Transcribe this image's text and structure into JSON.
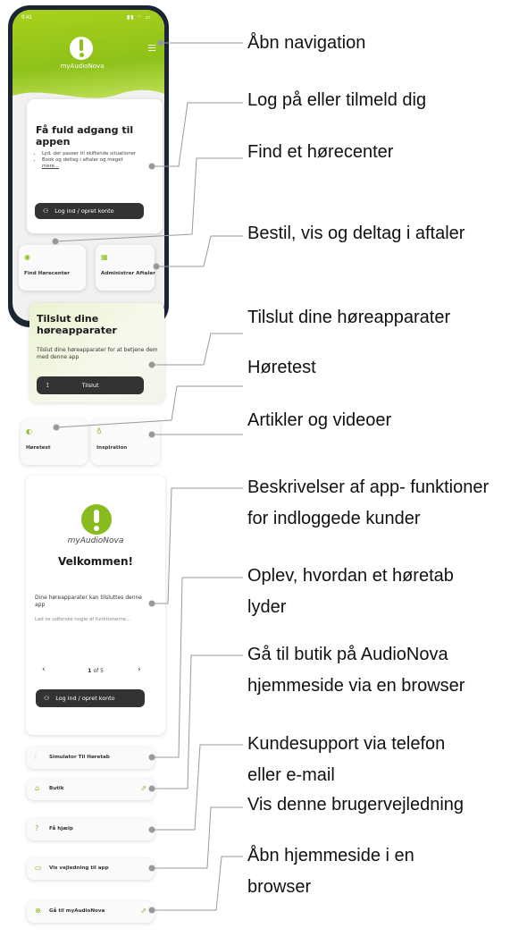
{
  "status": {
    "time": "9:41",
    "icons": "signal wifi battery"
  },
  "header": {
    "app_name": "myAudioNova",
    "menu_icon": "hamburger-icon"
  },
  "access_card": {
    "title": "Få fuld adgang til appen",
    "bullets": [
      "Lyd, der passer til skiftende situationer",
      "Book og deltag i aftaler og meget"
    ],
    "more": "mere...",
    "login": "Log ind / opret konto"
  },
  "tiles": {
    "find": {
      "label": "Find Hørecenter",
      "icon": "location-pin-icon"
    },
    "admin": {
      "label": "Administrer Aftaler",
      "icon": "calendar-icon"
    },
    "test": {
      "label": "Høretest",
      "icon": "ear-icon"
    },
    "inspiration": {
      "label": "Inspiration",
      "icon": "lightbulb-icon"
    }
  },
  "connect_card": {
    "title": "Tilslut dine høreapparater",
    "desc": "Tilslut dine høreapparater for at betjene dem med denne app",
    "button": "Tilslut"
  },
  "welcome_card": {
    "app_name": "myAudioNova",
    "title": "Velkommen!",
    "desc": "Dine høreapparater kan tilsluttes denne app",
    "sub": "Lad os udforske nogle af funktionerne...",
    "page_current": "1",
    "page_total": "of 5",
    "login": "Log ind / opret konto"
  },
  "rows": {
    "simulator": "Simulator Til Høretab",
    "shop": "Butik",
    "help": "Få hjælp",
    "guide": "Vis vejledning til app",
    "home": "Gå til myAudioNova"
  },
  "annotations": [
    "Åbn navigation",
    "Log på eller tilmeld dig",
    "Find et hørecenter",
    "Bestil, vis og deltag i aftaler",
    "Tilslut dine høreapparater",
    "Høretest",
    "Artikler og videoer",
    "Beskrivelser af app- funktioner",
    "for indloggede kunder",
    "Oplev, hvordan et høretab",
    "lyder",
    "Gå til butik på AudioNova",
    "hjemmeside via en browser",
    "Kundesupport via telefon",
    "eller e-mail",
    "Vis denne brugervejledning",
    "Åbn hjemmeside i en",
    "browser"
  ],
  "colors": {
    "accent": "#88bb1e",
    "header": "#8ec11a",
    "phone": "#1c2533",
    "button": "#333333"
  }
}
